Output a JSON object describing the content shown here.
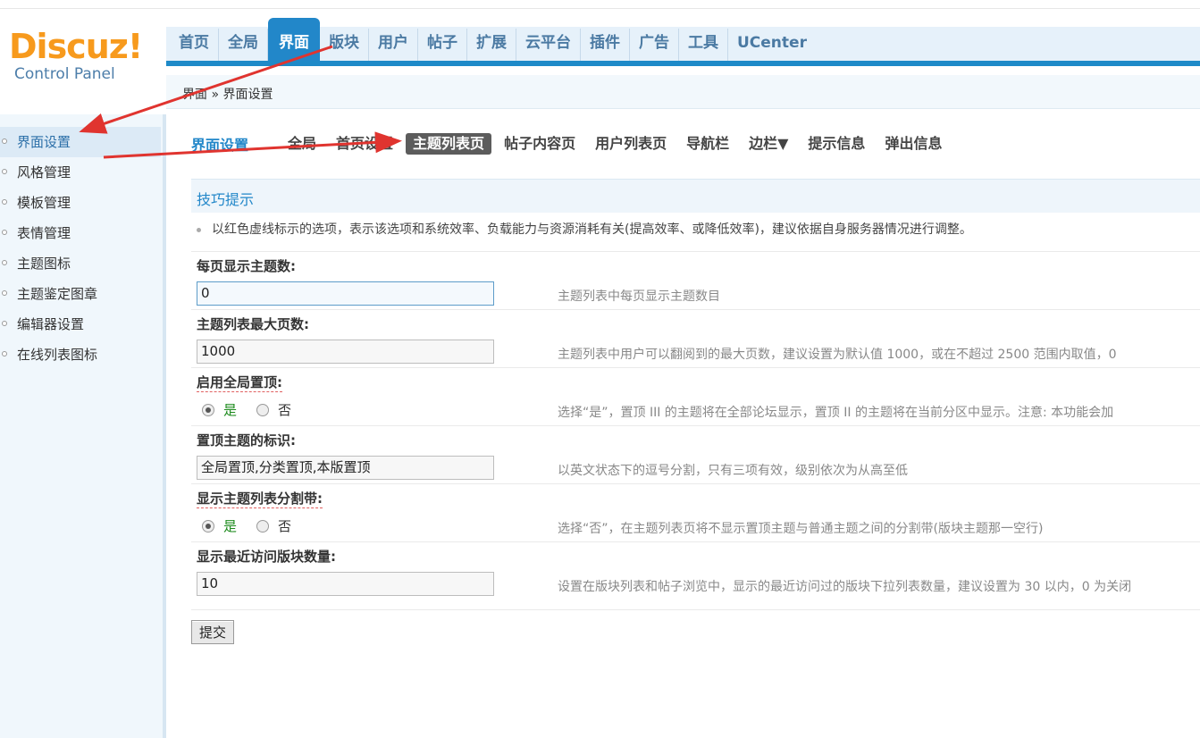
{
  "logo": {
    "brand": "Discuz",
    "bang": "!",
    "subtitle": "Control Panel"
  },
  "nav": {
    "items": [
      {
        "label": "首页"
      },
      {
        "label": "全局"
      },
      {
        "label": "界面"
      },
      {
        "label": "版块"
      },
      {
        "label": "用户"
      },
      {
        "label": "帖子"
      },
      {
        "label": "扩展"
      },
      {
        "label": "云平台"
      },
      {
        "label": "插件"
      },
      {
        "label": "广告"
      },
      {
        "label": "工具"
      },
      {
        "label": "UCenter"
      }
    ],
    "active_index": 2
  },
  "breadcrumb": "界面 » 界面设置",
  "sidebar": {
    "items": [
      {
        "label": "界面设置"
      },
      {
        "label": "风格管理"
      },
      {
        "label": "模板管理"
      },
      {
        "label": "表情管理"
      },
      {
        "label": "主题图标"
      },
      {
        "label": "主题鉴定图章"
      },
      {
        "label": "编辑器设置"
      },
      {
        "label": "在线列表图标"
      }
    ],
    "active_index": 0
  },
  "subnav": {
    "title": "界面设置",
    "tabs": [
      {
        "label": "全局"
      },
      {
        "label": "首页设置"
      },
      {
        "label": "主题列表页"
      },
      {
        "label": "帖子内容页"
      },
      {
        "label": "用户列表页"
      },
      {
        "label": "导航栏"
      },
      {
        "label": "边栏▼"
      },
      {
        "label": "提示信息"
      },
      {
        "label": "弹出信息"
      }
    ],
    "active_index": 2
  },
  "tips": {
    "title": "技巧提示",
    "text": "以红色虚线标示的选项，表示该选项和系统效率、负载能力与资源消耗有关(提高效率、或降低效率)，建议依据自身服务器情况进行调整。"
  },
  "form": {
    "topics_per_page": {
      "label": "每页显示主题数:",
      "value": "0",
      "hint": "主题列表中每页显示主题数目"
    },
    "max_pages": {
      "label": "主题列表最大页数:",
      "value": "1000",
      "hint": "主题列表中用户可以翻阅到的最大页数，建议设置为默认值 1000，或在不超过 2500 范围内取值，0"
    },
    "global_sticky": {
      "label": "启用全局置顶:",
      "yes": "是",
      "no": "否",
      "selected": "是",
      "hint": "选择“是”，置顶 III 的主题将在全部论坛显示，置顶 II 的主题将在当前分区中显示。注意: 本功能会加"
    },
    "sticky_labels": {
      "label": "置顶主题的标识:",
      "value": "全局置顶,分类置顶,本版置顶",
      "hint": "以英文状态下的逗号分割，只有三项有效，级别依次为从高至低"
    },
    "separator": {
      "label": "显示主题列表分割带:",
      "yes": "是",
      "no": "否",
      "selected": "是",
      "hint": "选择“否”，在主题列表页将不显示置顶主题与普通主题之间的分割带(版块主题那一空行)"
    },
    "recent_forums": {
      "label": "显示最近访问版块数量:",
      "value": "10",
      "hint": "设置在版块列表和帖子浏览中，显示的最近访问过的版块下拉列表数量，建议设置为 30 以内，0 为关闭"
    },
    "submit_label": "提交"
  },
  "colors": {
    "nav_blue": "#2287c9",
    "logo_orange": "#f79a1d",
    "annotation_red": "#e0342f"
  }
}
